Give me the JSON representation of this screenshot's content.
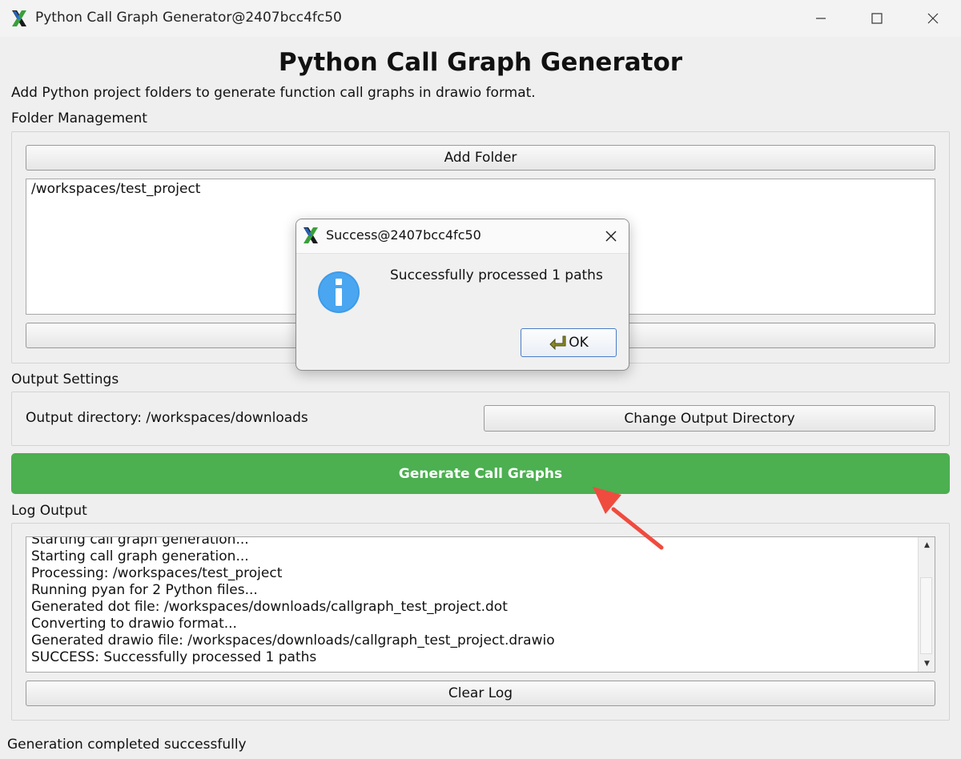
{
  "window": {
    "title": "Python Call Graph Generator@2407bcc4fc50"
  },
  "page": {
    "title": "Python Call Graph Generator",
    "subtitle": "Add Python project folders to generate function call graphs in drawio format."
  },
  "folder_management": {
    "label": "Folder Management",
    "add_folder_label": "Add Folder",
    "folders": [
      "/workspaces/test_project"
    ]
  },
  "output_settings": {
    "label": "Output Settings",
    "directory_text": "Output directory: /workspaces/downloads",
    "change_button_label": "Change Output Directory"
  },
  "generate": {
    "button_label": "Generate Call Graphs",
    "color": "#4caf50"
  },
  "log_output": {
    "label": "Log Output",
    "lines": [
      "Starting call graph generation...",
      "Starting call graph generation...",
      "Processing: /workspaces/test_project",
      "Running pyan for 2 Python files...",
      "Generated dot file: /workspaces/downloads/callgraph_test_project.dot",
      "Converting to drawio format...",
      "Generated drawio file: /workspaces/downloads/callgraph_test_project.drawio",
      "SUCCESS: Successfully processed 1 paths"
    ],
    "clear_button_label": "Clear Log"
  },
  "status_bar": {
    "text": "Generation completed successfully"
  },
  "dialog": {
    "title": "Success@2407bcc4fc50",
    "message": "Successfully processed 1 paths",
    "ok_label": "OK",
    "icon": "info-icon"
  },
  "annotation": {
    "arrow_color": "#f04b3f"
  }
}
